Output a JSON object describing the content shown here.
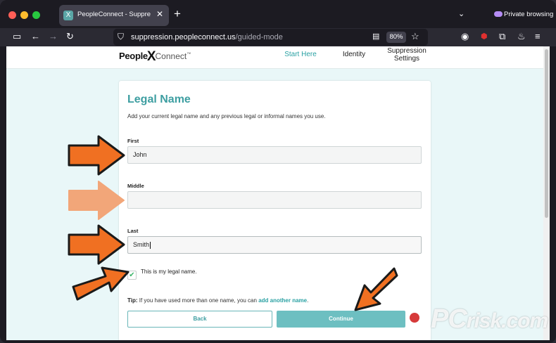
{
  "browser": {
    "tab_title": "PeopleConnect - Suppression C",
    "tab_favicon": "X",
    "tab_close": "✕",
    "new_tab": "+",
    "tabs_menu": "⌄",
    "private_label": "Private browsing",
    "url_host": "suppression.peopleconnect.us",
    "url_path": "/guided-mode",
    "zoom": "80%"
  },
  "site": {
    "logo_left": "People",
    "logo_x": "X",
    "logo_right": "Connect",
    "logo_tm": "™",
    "nav": {
      "start_here": "Start Here",
      "identity": "Identity",
      "suppression_line1": "Suppression",
      "suppression_line2": "Settings"
    }
  },
  "form": {
    "title": "Legal Name",
    "description": "Add your current legal name and any previous legal or informal names you use.",
    "first_label": "First",
    "first_value": "John",
    "middle_label": "Middle",
    "middle_value": "",
    "last_label": "Last",
    "last_value": "Smith",
    "legal_checkbox_label": "This is my legal name.",
    "legal_checked": true,
    "tip_label": "Tip:",
    "tip_text": " If you have used more than one name, you can ",
    "tip_link": "add another name",
    "tip_end": ".",
    "back_button": "Back",
    "continue_button": "Continue"
  },
  "watermark": {
    "pc": "PC",
    "risk": "risk.com"
  },
  "colors": {
    "accent": "#3d9ea1",
    "arrow": "#f07022",
    "arrow_light": "#f2a679"
  }
}
